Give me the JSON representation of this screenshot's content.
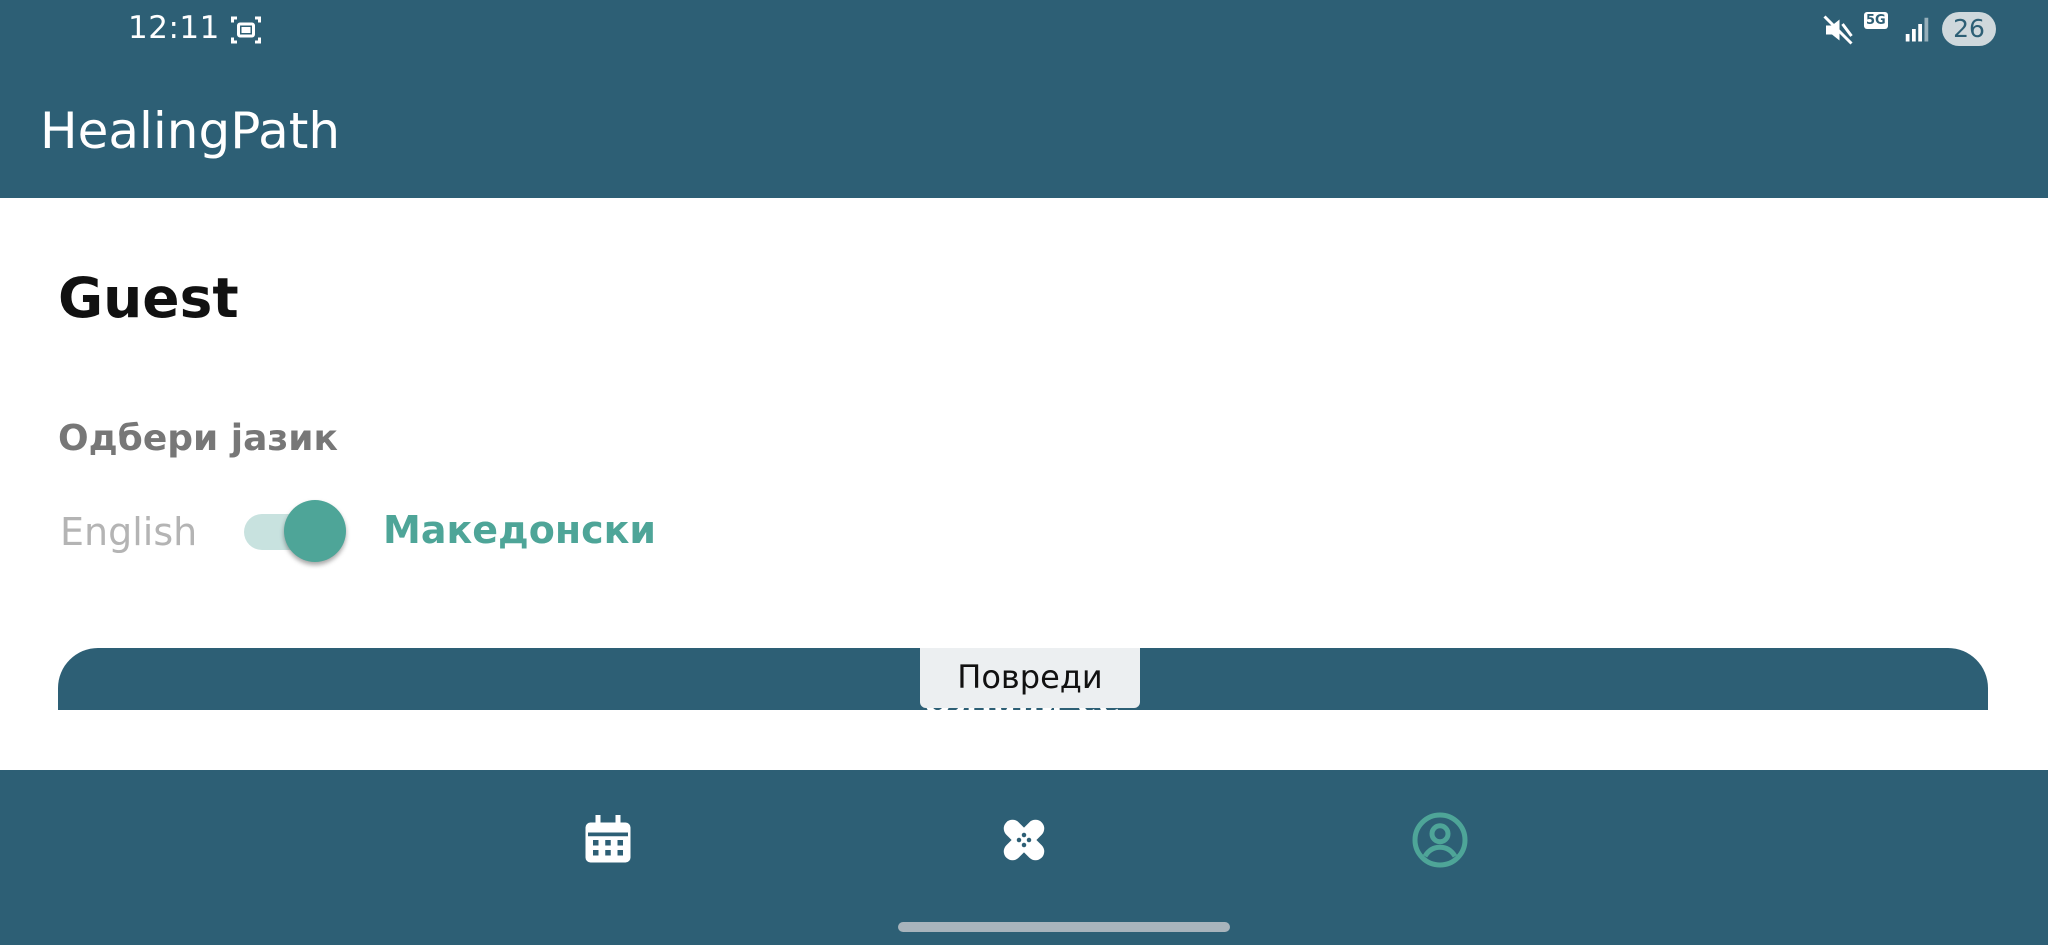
{
  "status_bar": {
    "time": "12:11",
    "network_label": "5G",
    "battery": "26",
    "icons": [
      "screenshot-icon",
      "mute-icon",
      "signal-icon"
    ]
  },
  "app_bar": {
    "title": "HealingPath"
  },
  "profile": {
    "user_name": "Guest",
    "language_label": "Одбери јазик",
    "language_option_left": "English",
    "language_option_right": "Македонски",
    "language_toggle_on": true
  },
  "main_button": {
    "label": "Одјави се"
  },
  "tooltip": {
    "text": "Повреди"
  },
  "bottom_nav": {
    "items": [
      {
        "name": "calendar",
        "icon": "calendar-icon"
      },
      {
        "name": "injuries",
        "icon": "bandage-icon"
      },
      {
        "name": "profile",
        "icon": "account-circle-icon"
      }
    ],
    "active": "profile"
  },
  "colors": {
    "primary": "#2d5f75",
    "accent": "#4ea598",
    "white": "#ffffff"
  }
}
